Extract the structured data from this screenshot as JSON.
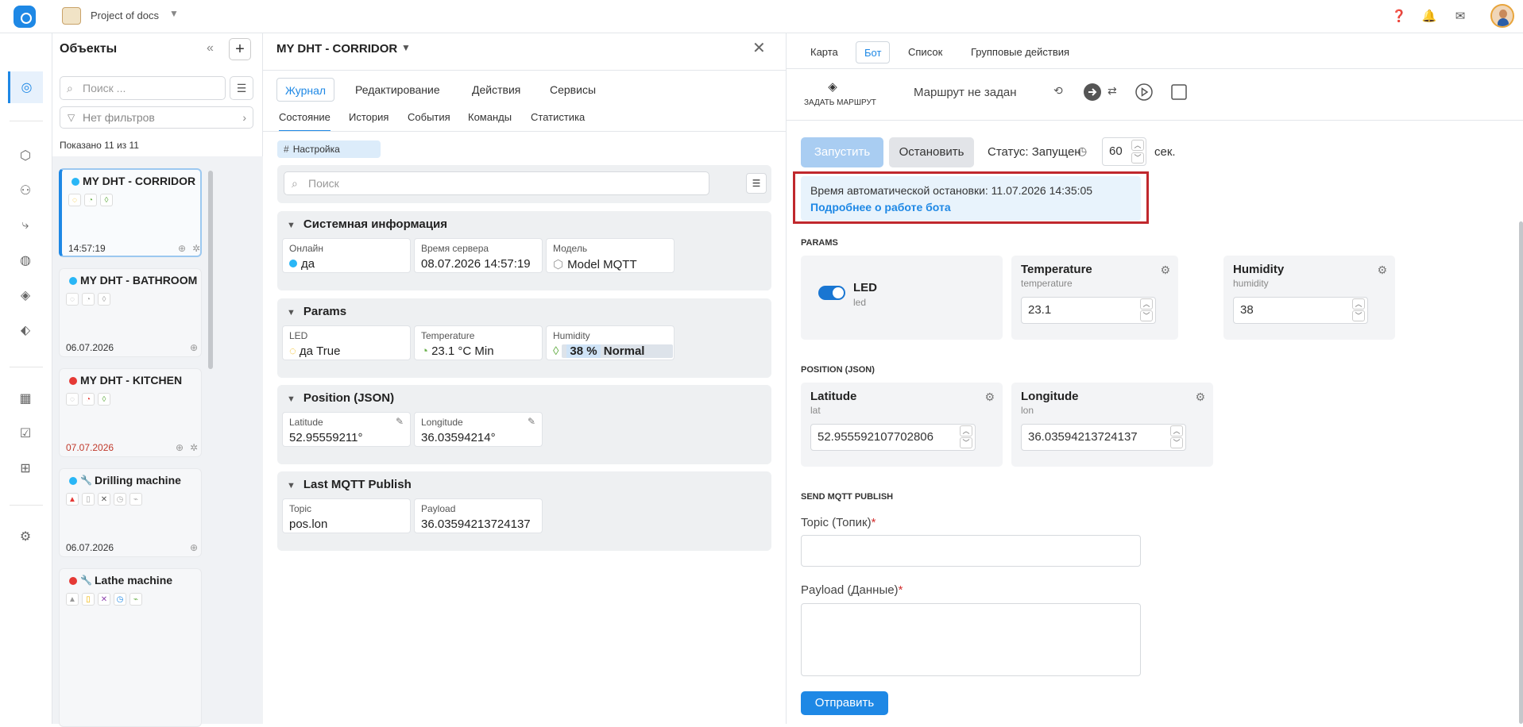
{
  "topbar": {
    "project_name": "Project of docs"
  },
  "objects_panel": {
    "title": "Объекты",
    "search_placeholder": "Поиск ...",
    "filter_label": "Нет фильтров",
    "shown_count": "Показано 11 из 11",
    "cards": [
      {
        "name": "MY DHT - CORRIDOR",
        "status_color": "#29b6f6",
        "time": "14:57:19"
      },
      {
        "name": "MY DHT - BATHROOM",
        "status_color": "#29b6f6",
        "time": "06.07.2026"
      },
      {
        "name": "MY DHT - KITCHEN",
        "status_color": "#e53935",
        "time": "07.07.2026"
      },
      {
        "name": "Drilling machine",
        "status_color": "#29b6f6",
        "time": "06.07.2026"
      },
      {
        "name": "Lathe machine",
        "status_color": "#e53935",
        "time": ""
      }
    ]
  },
  "object_detail": {
    "title": "MY DHT - CORRIDOR",
    "tabs": [
      "Журнал",
      "Редактирование",
      "Действия",
      "Сервисы"
    ],
    "subtabs": [
      "Состояние",
      "История",
      "События",
      "Команды",
      "Статистика"
    ],
    "tag": "Настройка",
    "search_placeholder": "Поиск",
    "sections": {
      "system": {
        "title": "Системная информация",
        "online_label": "Онлайн",
        "online_value": "да",
        "server_time_label": "Время сервера",
        "server_time_value": "08.07.2026 14:57:19",
        "model_label": "Модель",
        "model_value": "Model MQTT"
      },
      "params": {
        "title": "Params",
        "led_label": "LED",
        "led_value": "да True",
        "temp_label": "Temperature",
        "temp_value": "23.1 °C Min",
        "hum_label": "Humidity",
        "hum_value": "38 %",
        "hum_state": "Normal",
        "hum_level_percent": 38
      },
      "position": {
        "title": "Position (JSON)",
        "lat_label": "Latitude",
        "lat_value": "52.95559211°",
        "lon_label": "Longitude",
        "lon_value": "36.03594214°"
      },
      "mqtt": {
        "title": "Last MQTT Publish",
        "topic_label": "Topic",
        "topic_value": "pos.lon",
        "payload_label": "Payload",
        "payload_value": "36.03594213724137"
      }
    }
  },
  "bot_panel": {
    "tabs": [
      "Карта",
      "Бот",
      "Список",
      "Групповые действия"
    ],
    "route_button": "ЗАДАТЬ МАРШРУТ",
    "route_status": "Маршрут не задан",
    "start_button": "Запустить",
    "stop_button": "Остановить",
    "status_text": "Статус: Запущен",
    "interval_value": "60",
    "interval_unit": "сек.",
    "notice_text": "Время автоматической остановки: 11.07.2026 14:35:05",
    "notice_link": "Подробнее о работе бота",
    "params_label": "PARAMS",
    "led": {
      "name": "LED",
      "key": "led"
    },
    "temperature": {
      "name": "Temperature",
      "key": "temperature",
      "value": "23.1"
    },
    "humidity": {
      "name": "Humidity",
      "key": "humidity",
      "value": "38"
    },
    "position_label": "POSITION (JSON)",
    "latitude": {
      "name": "Latitude",
      "key": "lat",
      "value": "52.955592107702806"
    },
    "longitude": {
      "name": "Longitude",
      "key": "lon",
      "value": "36.03594213724137"
    },
    "mqtt_label": "SEND MQTT PUBLISH",
    "topic_label": "Topic (Топик)",
    "payload_label": "Payload (Данные)",
    "send_button": "Отправить"
  },
  "colors": {
    "accent": "#1e88e5",
    "highlight_border": "#c0282d",
    "notice_bg": "#e8f3fc"
  }
}
